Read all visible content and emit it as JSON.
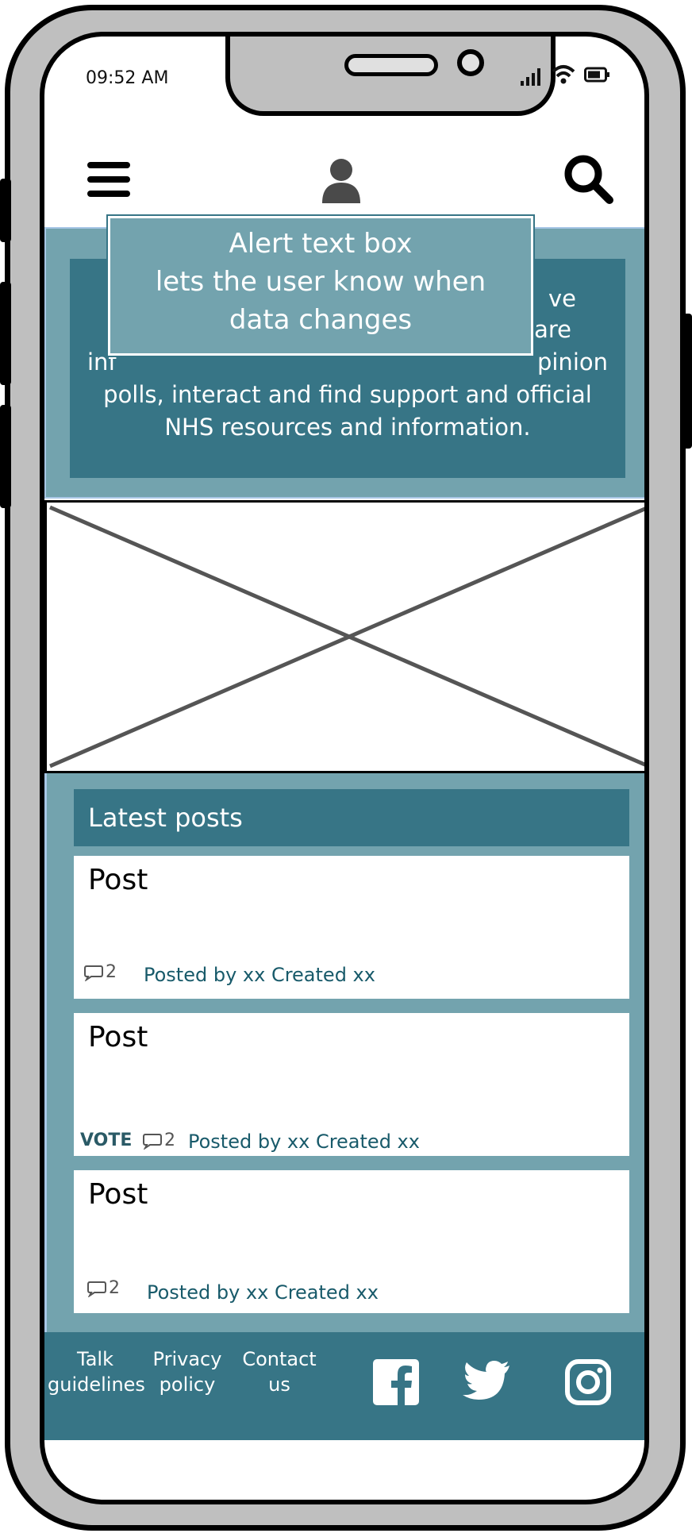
{
  "status_bar": {
    "time": "09:52 AM"
  },
  "header": {
    "menu_icon": "hamburger-icon",
    "profile_icon": "user-icon",
    "search_icon": "search-icon"
  },
  "hero": {
    "text": "…ve …are inf… …pinion polls, interact and find support and official NHS resources and information.",
    "line1_right": "ve",
    "line2_right": "are",
    "line3_left": "inf",
    "line3_right": "pinion",
    "line4": "polls, interact and find support and official",
    "line5": "NHS resources and information."
  },
  "alert": {
    "line1": "Alert text box",
    "line2": "lets the user know when",
    "line3": "data changes"
  },
  "image_placeholder": {
    "icon": "image-placeholder-icon"
  },
  "latest_posts": {
    "heading": "Latest posts",
    "posts": [
      {
        "title": "Post",
        "comments": "2",
        "meta": "Posted by  xx Created xx",
        "vote": ""
      },
      {
        "title": "Post",
        "comments": "2",
        "meta": "Posted by  xx Created xx",
        "vote": "VOTE"
      },
      {
        "title": "Post",
        "comments": "2",
        "meta": "Posted by  xx Created xx",
        "vote": ""
      }
    ]
  },
  "footer": {
    "links": [
      {
        "line1": "Talk",
        "line2": "guidelines"
      },
      {
        "line1": "Privacy",
        "line2": "policy"
      },
      {
        "line1": "Contact",
        "line2": "us"
      }
    ],
    "social": [
      "facebook-icon",
      "twitter-icon",
      "instagram-icon"
    ]
  },
  "colors": {
    "teal_dark": "#377586",
    "teal_light": "#73a3ae",
    "meta_text": "#185a6a"
  }
}
